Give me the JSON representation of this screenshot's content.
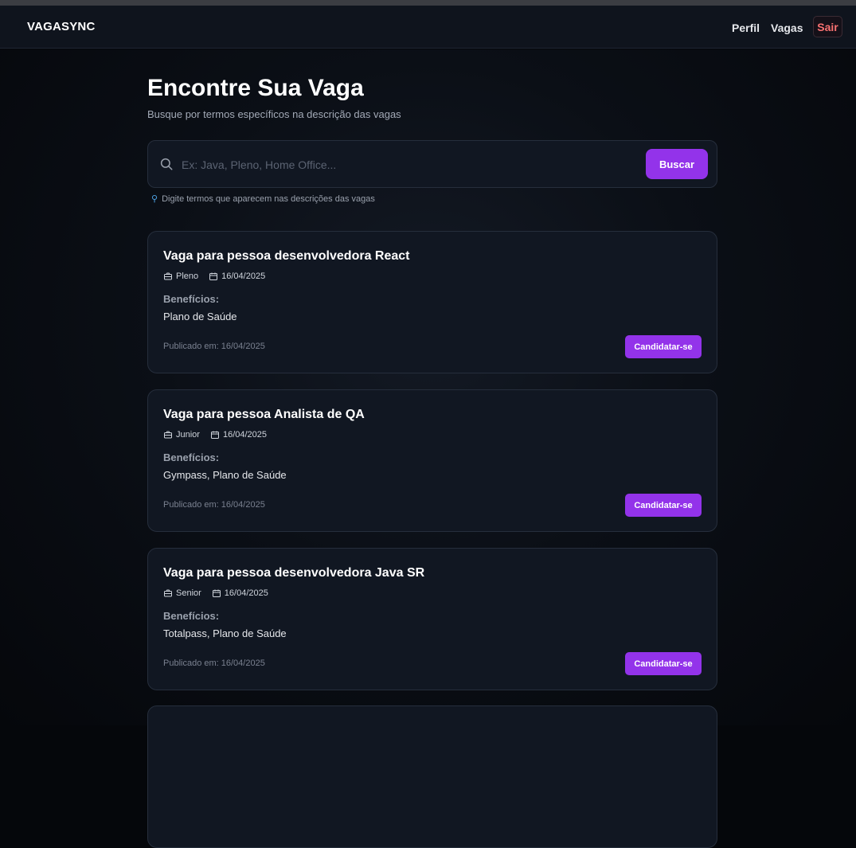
{
  "navbar": {
    "brand": "VAGASYNC",
    "links": [
      {
        "label": "Perfil"
      },
      {
        "label": "Vagas"
      }
    ],
    "logout_label": "Sair"
  },
  "header": {
    "title": "Encontre Sua Vaga",
    "subtitle": "Busque por termos específicos na descrição das vagas"
  },
  "search": {
    "placeholder": "Ex: Java, Pleno, Home Office...",
    "value": "",
    "button_label": "Buscar",
    "hint": "Digite termos que aparecem nas descrições das vagas",
    "hint_icon": "magnifier-icon"
  },
  "jobs": [
    {
      "title": "Vaga para pessoa desenvolvedora React",
      "level": "Pleno",
      "date": "16/04/2025",
      "benefits_label": "Benefícios:",
      "benefits": "Plano de Saúde",
      "published": "Publicado em: 16/04/2025",
      "apply_label": "Candidatar-se"
    },
    {
      "title": "Vaga para pessoa Analista de QA",
      "level": "Junior",
      "date": "16/04/2025",
      "benefits_label": "Benefícios:",
      "benefits": "Gympass, Plano de Saúde",
      "published": "Publicado em: 16/04/2025",
      "apply_label": "Candidatar-se"
    },
    {
      "title": "Vaga para pessoa desenvolvedora Java SR",
      "level": "Senior",
      "date": "16/04/2025",
      "benefits_label": "Benefícios:",
      "benefits": "Totalpass, Plano de Saúde",
      "published": "Publicado em: 16/04/2025",
      "apply_label": "Candidatar-se"
    }
  ],
  "colors": {
    "accent": "#9333ea",
    "logout": "#f87171",
    "card_bg": "#111722",
    "page_bg": "#05070b"
  }
}
